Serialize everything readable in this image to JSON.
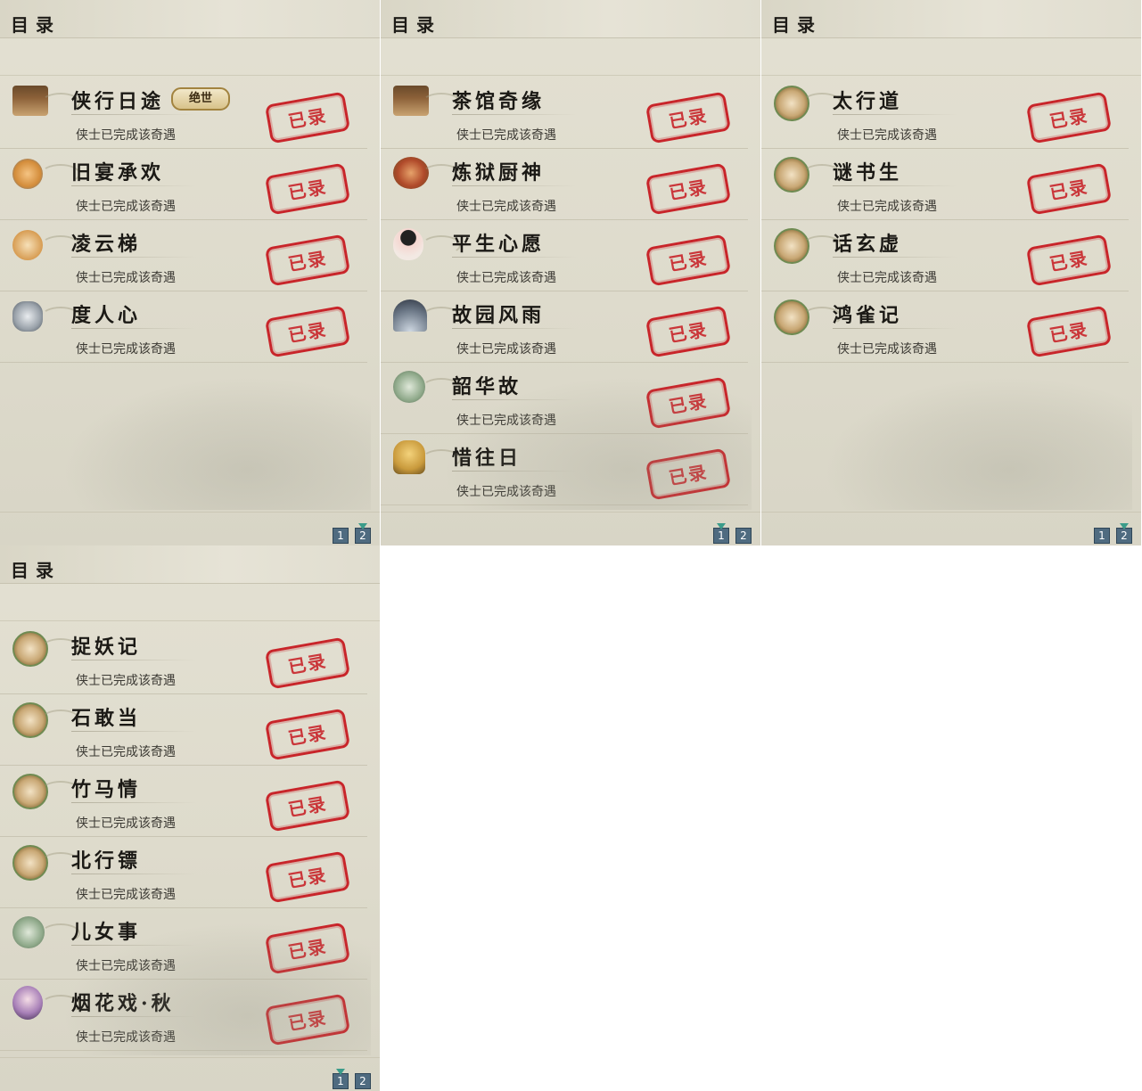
{
  "panels": [
    {
      "title": "目录",
      "items": [
        {
          "name": "侠行日途",
          "badge": "绝世",
          "status": "侠士已完成该奇遇",
          "stamp": "已录",
          "icon": "pavilion-icon"
        },
        {
          "name": "旧宴承欢",
          "status": "侠士已完成该奇遇",
          "stamp": "已录",
          "icon": "thumbs-up-icon"
        },
        {
          "name": "凌云梯",
          "status": "侠士已完成该奇遇",
          "stamp": "已录",
          "icon": "mask-face-icon"
        },
        {
          "name": "度人心",
          "status": "侠士已完成该奇遇",
          "stamp": "已录",
          "icon": "opera-mask-icon"
        }
      ],
      "pages": [
        "1",
        "2"
      ],
      "active_page": "2"
    },
    {
      "title": "目录",
      "items": [
        {
          "name": "茶馆奇缘",
          "status": "侠士已完成该奇遇",
          "stamp": "已录",
          "icon": "teahouse-icon"
        },
        {
          "name": "炼狱厨神",
          "status": "侠士已完成该奇遇",
          "stamp": "已录",
          "icon": "food-bowl-icon"
        },
        {
          "name": "平生心愿",
          "status": "侠士已完成该奇遇",
          "stamp": "已录",
          "icon": "official-figure-icon"
        },
        {
          "name": "故园风雨",
          "status": "侠士已完成该奇遇",
          "stamp": "已录",
          "icon": "folding-fan-icon"
        },
        {
          "name": "韶华故",
          "status": "侠士已完成该奇遇",
          "stamp": "已录",
          "icon": "landscape-icon"
        },
        {
          "name": "惜往日",
          "status": "侠士已完成该奇遇",
          "stamp": "已录",
          "icon": "golden-buddha-icon"
        }
      ],
      "pages": [
        "1",
        "2"
      ],
      "active_page": "1"
    },
    {
      "title": "目录",
      "items": [
        {
          "name": "太行道",
          "status": "侠士已完成该奇遇",
          "stamp": "已录",
          "icon": "cat-icon"
        },
        {
          "name": "谜书生",
          "status": "侠士已完成该奇遇",
          "stamp": "已录",
          "icon": "cat-icon"
        },
        {
          "name": "话玄虚",
          "status": "侠士已完成该奇遇",
          "stamp": "已录",
          "icon": "cat-icon"
        },
        {
          "name": "鸿雀记",
          "status": "侠士已完成该奇遇",
          "stamp": "已录",
          "icon": "cat-icon"
        }
      ],
      "pages": [
        "1",
        "2"
      ],
      "active_page": "2"
    },
    {
      "title": "目录",
      "items": [
        {
          "name": "捉妖记",
          "status": "侠士已完成该奇遇",
          "stamp": "已录",
          "icon": "cat-icon"
        },
        {
          "name": "石敢当",
          "status": "侠士已完成该奇遇",
          "stamp": "已录",
          "icon": "cat-icon"
        },
        {
          "name": "竹马情",
          "status": "侠士已完成该奇遇",
          "stamp": "已录",
          "icon": "cat-icon"
        },
        {
          "name": "北行镖",
          "status": "侠士已完成该奇遇",
          "stamp": "已录",
          "icon": "cat-icon"
        },
        {
          "name": "儿女事",
          "status": "侠士已完成该奇遇",
          "stamp": "已录",
          "icon": "landscape-icon"
        },
        {
          "name": "烟花戏·秋",
          "status": "侠士已完成该奇遇",
          "stamp": "已录",
          "icon": "lady-portrait-icon"
        }
      ],
      "pages": [
        "1",
        "2"
      ],
      "active_page": "1"
    }
  ],
  "colors": {
    "stamp_red": "#c8252a",
    "page_button": "#4f6b80",
    "panel_bg": "#e0ddcf"
  }
}
